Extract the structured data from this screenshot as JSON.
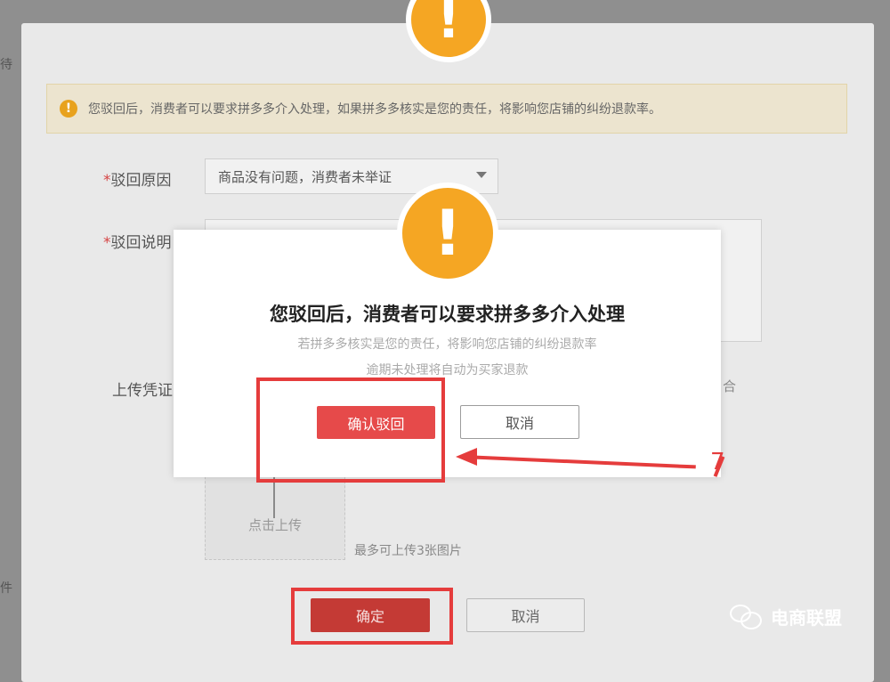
{
  "background_page": {
    "left_fragment_top": "待",
    "left_fragment_bottom": "件"
  },
  "back_dialog": {
    "notice_text": "您驳回后，消费者可以要求拼多多介入处理，如果拼多多核实是您的责任，将影响您店铺的纠纷退款率。",
    "reason_label": "驳回原因",
    "reason_value": "商品没有问题，消费者未举证",
    "explain_label": "驳回说明",
    "upload_label": "上传凭证",
    "upload_button": "点击上传",
    "upload_hint": "最多可上传3张图片",
    "right_hint": "合",
    "confirm_label": "确定",
    "cancel_label": "取消",
    "required_mark": "*"
  },
  "modal": {
    "icon": "warning-icon",
    "title": "您驳回后，消费者可以要求拼多多介入处理",
    "subtitle_1": "若拼多多核实是您的责任，将影响您店铺的纠纷退款率",
    "subtitle_2": "逾期未处理将自动为买家退款",
    "confirm_label": "确认驳回",
    "cancel_label": "取消"
  },
  "annotation_number": "7",
  "watermark": {
    "icon": "wechat-icon",
    "text": "电商联盟"
  },
  "colors": {
    "warning": "#f5a623",
    "primary_red": "#e64a4a",
    "annotation_red": "#e53c3c"
  }
}
